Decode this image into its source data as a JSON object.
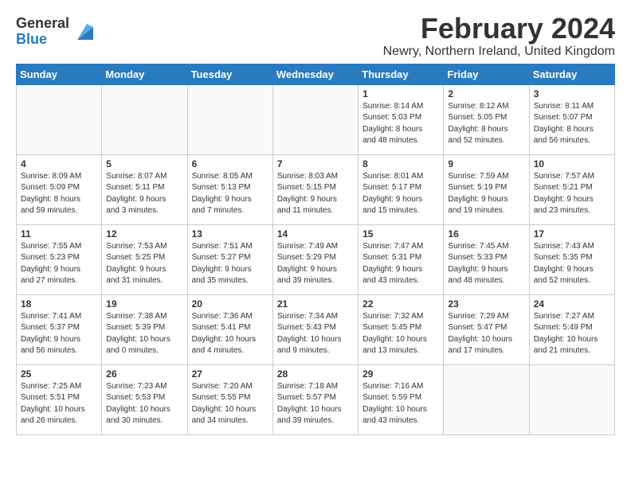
{
  "header": {
    "logo_line1": "General",
    "logo_line2": "Blue",
    "month_year": "February 2024",
    "location": "Newry, Northern Ireland, United Kingdom"
  },
  "weekdays": [
    "Sunday",
    "Monday",
    "Tuesday",
    "Wednesday",
    "Thursday",
    "Friday",
    "Saturday"
  ],
  "weeks": [
    [
      {
        "day": "",
        "info": ""
      },
      {
        "day": "",
        "info": ""
      },
      {
        "day": "",
        "info": ""
      },
      {
        "day": "",
        "info": ""
      },
      {
        "day": "1",
        "info": "Sunrise: 8:14 AM\nSunset: 5:03 PM\nDaylight: 8 hours\nand 48 minutes."
      },
      {
        "day": "2",
        "info": "Sunrise: 8:12 AM\nSunset: 5:05 PM\nDaylight: 8 hours\nand 52 minutes."
      },
      {
        "day": "3",
        "info": "Sunrise: 8:11 AM\nSunset: 5:07 PM\nDaylight: 8 hours\nand 56 minutes."
      }
    ],
    [
      {
        "day": "4",
        "info": "Sunrise: 8:09 AM\nSunset: 5:09 PM\nDaylight: 8 hours\nand 59 minutes."
      },
      {
        "day": "5",
        "info": "Sunrise: 8:07 AM\nSunset: 5:11 PM\nDaylight: 9 hours\nand 3 minutes."
      },
      {
        "day": "6",
        "info": "Sunrise: 8:05 AM\nSunset: 5:13 PM\nDaylight: 9 hours\nand 7 minutes."
      },
      {
        "day": "7",
        "info": "Sunrise: 8:03 AM\nSunset: 5:15 PM\nDaylight: 9 hours\nand 11 minutes."
      },
      {
        "day": "8",
        "info": "Sunrise: 8:01 AM\nSunset: 5:17 PM\nDaylight: 9 hours\nand 15 minutes."
      },
      {
        "day": "9",
        "info": "Sunrise: 7:59 AM\nSunset: 5:19 PM\nDaylight: 9 hours\nand 19 minutes."
      },
      {
        "day": "10",
        "info": "Sunrise: 7:57 AM\nSunset: 5:21 PM\nDaylight: 9 hours\nand 23 minutes."
      }
    ],
    [
      {
        "day": "11",
        "info": "Sunrise: 7:55 AM\nSunset: 5:23 PM\nDaylight: 9 hours\nand 27 minutes."
      },
      {
        "day": "12",
        "info": "Sunrise: 7:53 AM\nSunset: 5:25 PM\nDaylight: 9 hours\nand 31 minutes."
      },
      {
        "day": "13",
        "info": "Sunrise: 7:51 AM\nSunset: 5:27 PM\nDaylight: 9 hours\nand 35 minutes."
      },
      {
        "day": "14",
        "info": "Sunrise: 7:49 AM\nSunset: 5:29 PM\nDaylight: 9 hours\nand 39 minutes."
      },
      {
        "day": "15",
        "info": "Sunrise: 7:47 AM\nSunset: 5:31 PM\nDaylight: 9 hours\nand 43 minutes."
      },
      {
        "day": "16",
        "info": "Sunrise: 7:45 AM\nSunset: 5:33 PM\nDaylight: 9 hours\nand 48 minutes."
      },
      {
        "day": "17",
        "info": "Sunrise: 7:43 AM\nSunset: 5:35 PM\nDaylight: 9 hours\nand 52 minutes."
      }
    ],
    [
      {
        "day": "18",
        "info": "Sunrise: 7:41 AM\nSunset: 5:37 PM\nDaylight: 9 hours\nand 56 minutes."
      },
      {
        "day": "19",
        "info": "Sunrise: 7:38 AM\nSunset: 5:39 PM\nDaylight: 10 hours\nand 0 minutes."
      },
      {
        "day": "20",
        "info": "Sunrise: 7:36 AM\nSunset: 5:41 PM\nDaylight: 10 hours\nand 4 minutes."
      },
      {
        "day": "21",
        "info": "Sunrise: 7:34 AM\nSunset: 5:43 PM\nDaylight: 10 hours\nand 9 minutes."
      },
      {
        "day": "22",
        "info": "Sunrise: 7:32 AM\nSunset: 5:45 PM\nDaylight: 10 hours\nand 13 minutes."
      },
      {
        "day": "23",
        "info": "Sunrise: 7:29 AM\nSunset: 5:47 PM\nDaylight: 10 hours\nand 17 minutes."
      },
      {
        "day": "24",
        "info": "Sunrise: 7:27 AM\nSunset: 5:49 PM\nDaylight: 10 hours\nand 21 minutes."
      }
    ],
    [
      {
        "day": "25",
        "info": "Sunrise: 7:25 AM\nSunset: 5:51 PM\nDaylight: 10 hours\nand 26 minutes."
      },
      {
        "day": "26",
        "info": "Sunrise: 7:23 AM\nSunset: 5:53 PM\nDaylight: 10 hours\nand 30 minutes."
      },
      {
        "day": "27",
        "info": "Sunrise: 7:20 AM\nSunset: 5:55 PM\nDaylight: 10 hours\nand 34 minutes."
      },
      {
        "day": "28",
        "info": "Sunrise: 7:18 AM\nSunset: 5:57 PM\nDaylight: 10 hours\nand 39 minutes."
      },
      {
        "day": "29",
        "info": "Sunrise: 7:16 AM\nSunset: 5:59 PM\nDaylight: 10 hours\nand 43 minutes."
      },
      {
        "day": "",
        "info": ""
      },
      {
        "day": "",
        "info": ""
      }
    ]
  ]
}
